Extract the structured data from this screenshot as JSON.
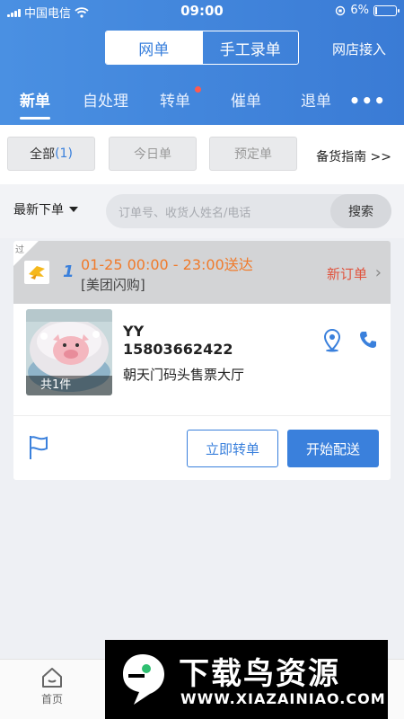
{
  "status_bar": {
    "carrier": "中国电信",
    "time": "09:00",
    "battery": "6%",
    "battery_level": 0.06
  },
  "header": {
    "segment": [
      {
        "label": "网单",
        "active": true
      },
      {
        "label": "手工录单",
        "active": false
      }
    ],
    "shop_link": "网店接入",
    "tabs": [
      {
        "label": "新单",
        "active": true
      },
      {
        "label": "自处理"
      },
      {
        "label": "转单",
        "badge_dot": true
      },
      {
        "label": "催单"
      },
      {
        "label": "退单"
      }
    ],
    "more": "•••"
  },
  "filters": {
    "all_label": "全部",
    "all_count": "(1)",
    "today": "今日单",
    "preorder": "预定单",
    "guide": "备货指南 >>"
  },
  "search": {
    "sort_label": "最新下单",
    "placeholder": "订单号、收货人姓名/电话",
    "button": "搜索"
  },
  "order": {
    "corner_tag": "过",
    "number": "1",
    "delivery_time": "01-25 00:00 - 23:00送达",
    "platform": "[美团闪购]",
    "status": "新订单",
    "item_count": "共1件",
    "customer_name": "YY",
    "customer_phone": "15803662422",
    "address": "朝天门码头售票大厅",
    "transfer_button": "立即转单",
    "deliver_button": "开始配送"
  },
  "colors": {
    "primary": "#3a80dc",
    "accent_orange": "#f07a2a",
    "status_red": "#e0533d"
  },
  "bottom_nav": {
    "home": "首页"
  },
  "watermark": {
    "title": "下载鸟资源",
    "url": "WWW.XIAZAINIAO.COM"
  }
}
